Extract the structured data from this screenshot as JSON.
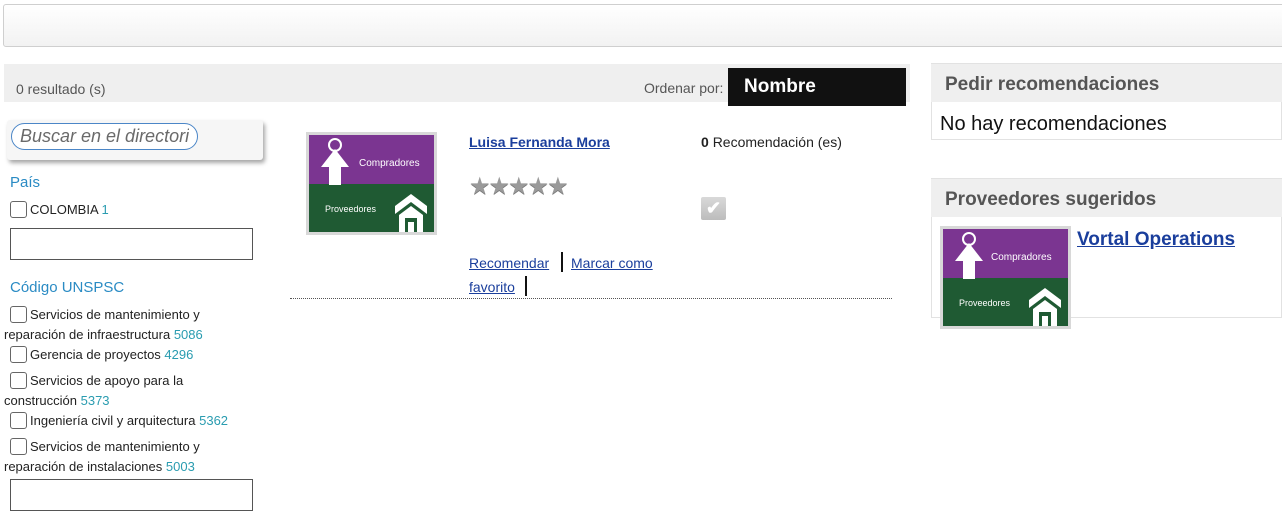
{
  "results": {
    "count_label": "0 resultado (s)",
    "sort_label": "Ordenar por:",
    "sort_value": "Nombre"
  },
  "search": {
    "placeholder": "Buscar en el directorio"
  },
  "filters": {
    "country": {
      "title": "País",
      "options": [
        {
          "label": "COLOMBIA",
          "count": "1"
        }
      ]
    },
    "unspsc": {
      "title": "Código UNSPSC",
      "options": [
        {
          "label_line1": "Servicios de mantenimiento y",
          "label_line2": "reparación de infraestructura",
          "count": "5086"
        },
        {
          "label_line1": "Gerencia de proyectos",
          "count": "4296"
        },
        {
          "label_line1": "Servicios de apoyo para la",
          "label_line2": "construcción",
          "count": "5373"
        },
        {
          "label_line1": "Ingeniería civil y arquitectura",
          "count": "5362"
        },
        {
          "label_line1": "Servicios de mantenimiento y",
          "label_line2": "reparación de instalaciones",
          "count": "5003"
        }
      ]
    }
  },
  "result_item": {
    "name": "Luisa Fernanda Mora",
    "recommendations_count": "0",
    "recommendations_label": "Recomendación (es)",
    "rating_stars": 0,
    "recommend_link": "Recomendar",
    "favorite_link_line1": "Marcar como",
    "favorite_link_line2": "favorito",
    "logo": {
      "top_text": "Compradores",
      "bottom_text": "Proveedores",
      "top_color": "#7b3591",
      "bottom_color": "#1f5a33"
    }
  },
  "recommendations_panel": {
    "title": "Pedir recomendaciones",
    "empty_text": "No hay recomendaciones"
  },
  "suggested_panel": {
    "title": "Proveedores sugeridos",
    "supplier_name": "Vortal Operations",
    "logo": {
      "top_text": "Compradores",
      "bottom_text": "Proveedores"
    }
  },
  "colors": {
    "accent_link": "#1a3e9c",
    "filter_title": "#2a8bc4",
    "count": "#2a9cb0"
  }
}
